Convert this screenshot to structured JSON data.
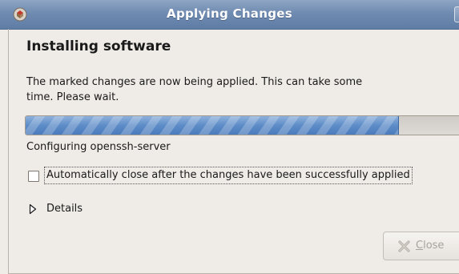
{
  "window": {
    "title": "Applying Changes"
  },
  "content": {
    "heading": "Installing software",
    "description": "The marked changes are now being applied. This can take some time. Please wait.",
    "progress_fraction": 0.83,
    "status": "Configuring openssh-server",
    "auto_close_label": "Automatically close after the changes have been successfully applied",
    "auto_close_checked": false,
    "details_label": "Details"
  },
  "buttons": {
    "close_mnemonic": "C",
    "close_rest": "lose",
    "close_enabled": false
  },
  "colors": {
    "titlebar": "#6f8bb1",
    "progress_fill": "#5d8cc7",
    "background": "#efebe7"
  },
  "icons": {
    "app": "package-icon",
    "expander": "triangle-right-icon",
    "close": "x-icon"
  }
}
